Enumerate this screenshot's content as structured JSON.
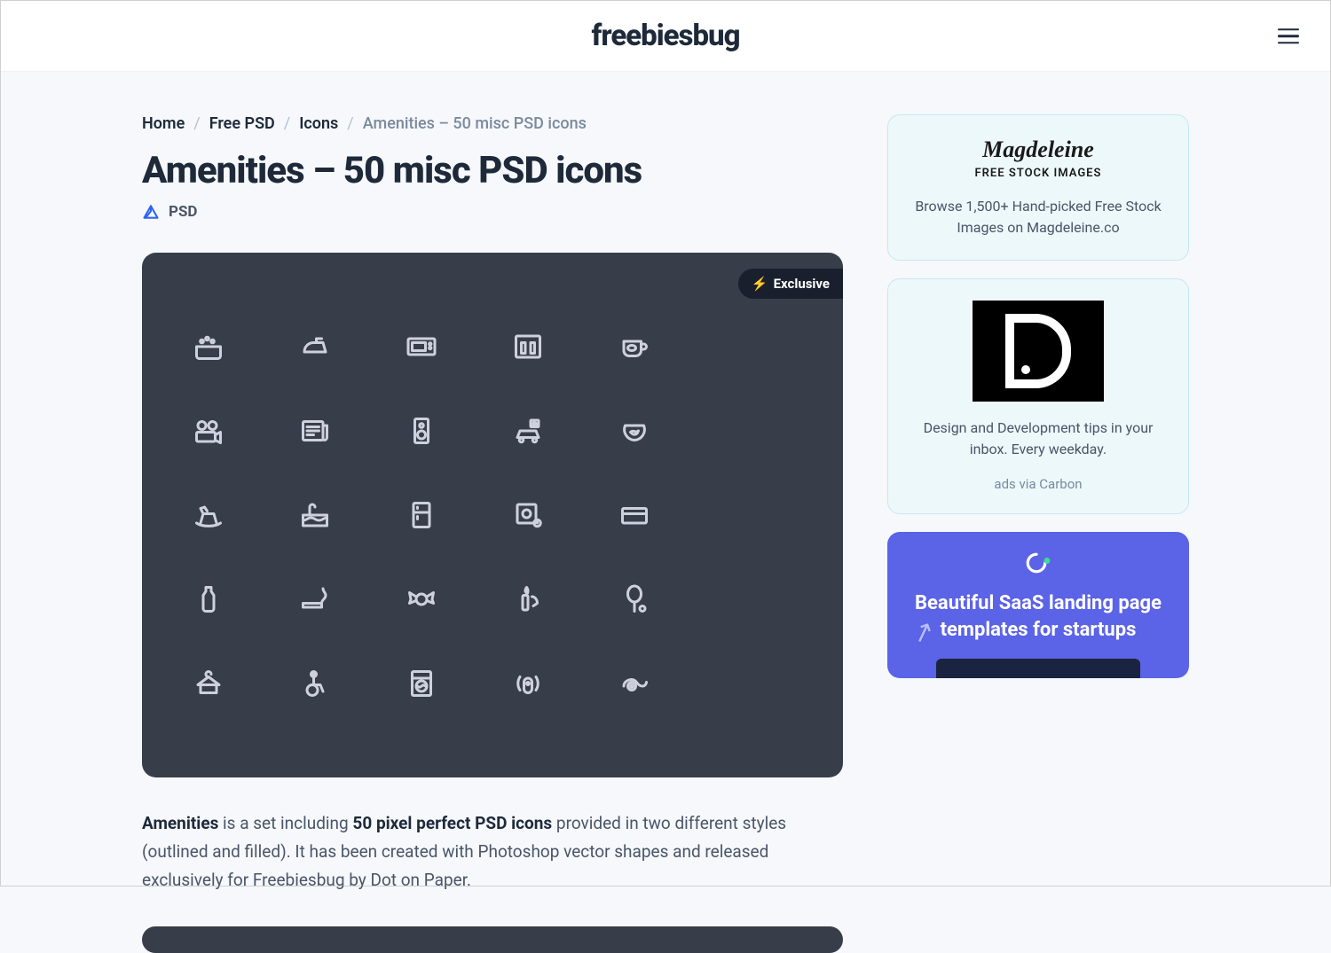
{
  "header": {
    "logo": "freebiesbug"
  },
  "breadcrumb": {
    "items": [
      "Home",
      "Free PSD",
      "Icons"
    ],
    "current": "Amenities – 50 misc PSD icons"
  },
  "page": {
    "title": "Amenities – 50 misc PSD icons",
    "format_label": "PSD",
    "exclusive_badge": "Exclusive"
  },
  "icon_names": [
    "jacuzzi-icon",
    "iron-icon",
    "microwave-icon",
    "toiletries-icon",
    "coffee-icon",
    "videocamera-icon",
    "newspaper-icon",
    "speaker-icon",
    "parking-icon",
    "fishbowl-icon",
    "rocking-horse-icon",
    "pool-icon",
    "fridge-icon",
    "safe-icon",
    "creditcard-icon",
    "bottle-icon",
    "smoking-icon",
    "candy-icon",
    "candle-icon",
    "tennis-icon",
    "hanger-icon",
    "wheelchair-icon",
    "washer-icon",
    "sensor-icon",
    "towel-icon"
  ],
  "description": {
    "strong1": "Amenities",
    "text1": " is a set including ",
    "strong2": "50 pixel perfect PSD icons",
    "text2": " provided in two different styles (outlined and filled). It has been created with Photoshop vector shapes and released exclusively for Freebiesbug by Dot on Paper."
  },
  "sidebar": {
    "magdeleine": {
      "title": "Magdeleine",
      "subtitle": "FREE STOCK IMAGES",
      "text": "Browse 1,500+ Hand-picked Free Stock Images on Magdeleine.co"
    },
    "carbon": {
      "text": "Design and Development tips in your inbox. Every weekday.",
      "via": "ads via Carbon"
    },
    "saas": {
      "title": "Beautiful SaaS landing page templates for startups"
    }
  }
}
